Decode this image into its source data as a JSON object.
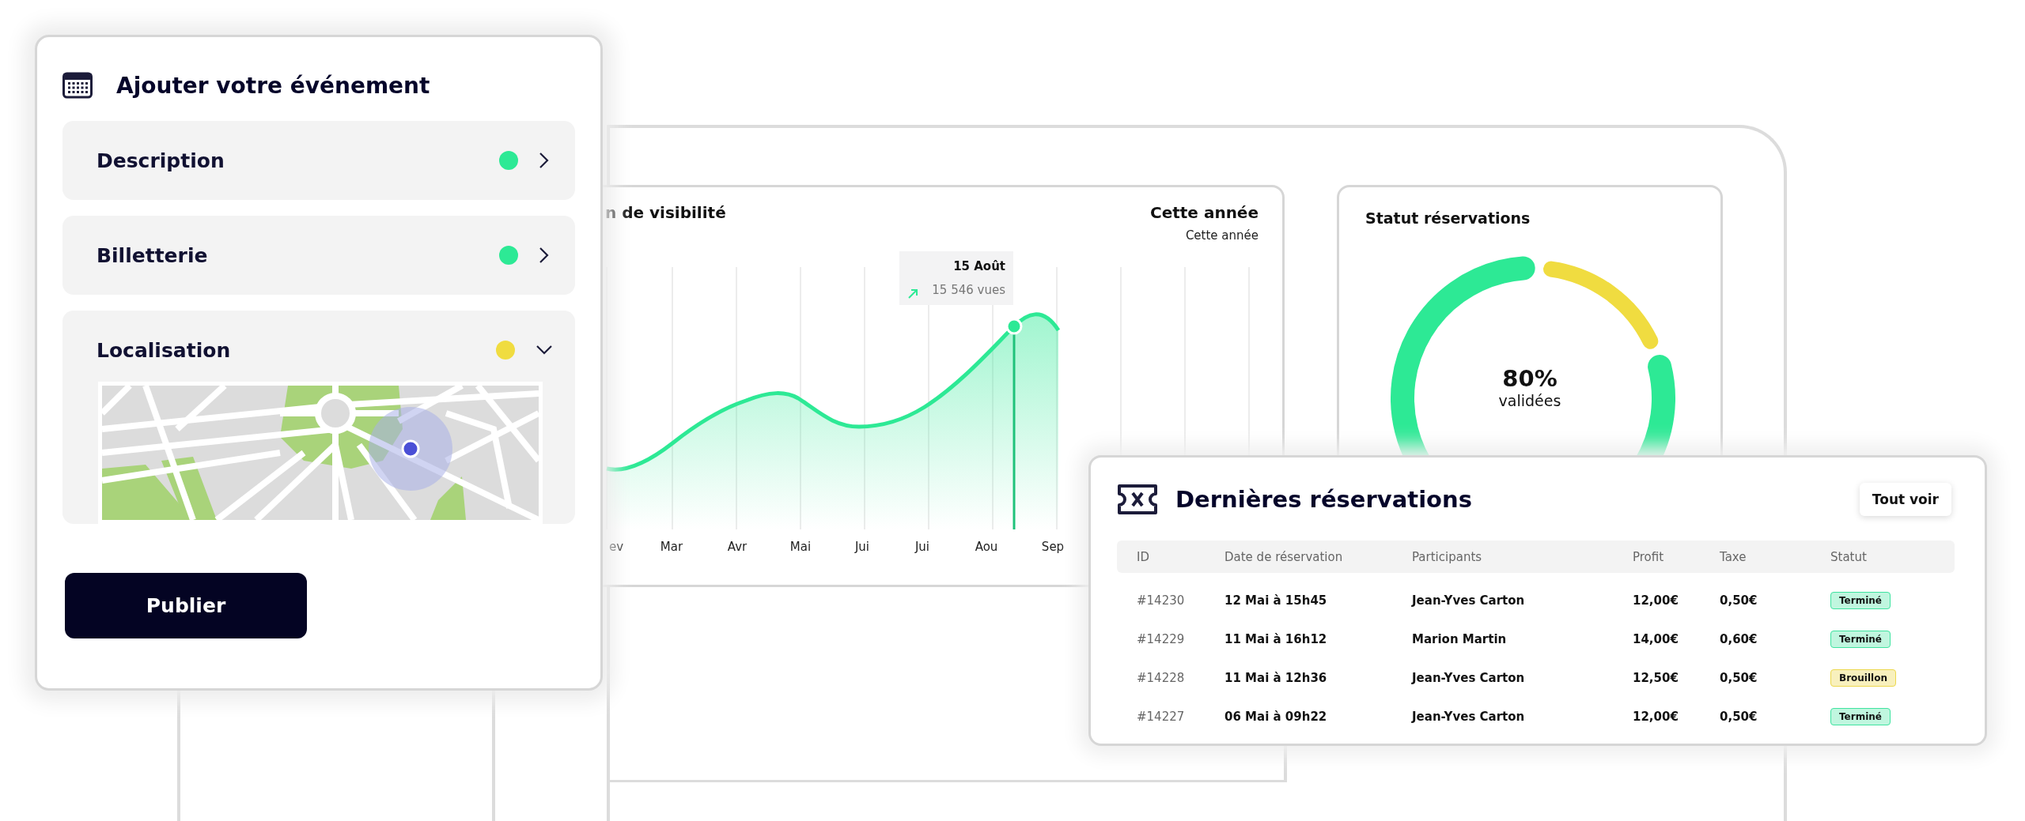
{
  "event_form": {
    "title": "Ajouter votre événement",
    "sections": [
      {
        "label": "Description",
        "color": "#2de995",
        "expanded": false
      },
      {
        "label": "Billetterie",
        "color": "#2de995",
        "expanded": false
      },
      {
        "label": "Localisation",
        "color": "#f0dc40",
        "expanded": true
      }
    ],
    "publish_button": "Publier"
  },
  "visibility_chart": {
    "title": "n de visibilité",
    "period_select": "Cette année",
    "period_label": "Cette année",
    "x_labels": [
      "ev",
      "Mar",
      "Avr",
      "Mai",
      "Jui",
      "Jui",
      "Aou",
      "Sep"
    ],
    "tooltip": {
      "date": "15 Août",
      "value": "15 546 vues"
    }
  },
  "booking_status": {
    "title": "Statut réservations",
    "percent": "80%",
    "caption": "validées"
  },
  "recent_bookings": {
    "title": "Dernières réservations",
    "view_all_button": "Tout voir",
    "columns": [
      "ID",
      "Date de réservation",
      "Participants",
      "Profit",
      "Taxe",
      "Statut"
    ],
    "rows": [
      {
        "id": "#14230",
        "date": "12 Mai à 15h45",
        "participant": "Jean-Yves Carton",
        "profit": "12,00€",
        "tax": "0,50€",
        "status": {
          "label": "Terminé",
          "kind": "done"
        }
      },
      {
        "id": "#14229",
        "date": "11 Mai à 16h12",
        "participant": "Marion Martin",
        "profit": "14,00€",
        "tax": "0,60€",
        "status": {
          "label": "Terminé",
          "kind": "done"
        }
      },
      {
        "id": "#14228",
        "date": "11 Mai à 12h36",
        "participant": "Jean-Yves Carton",
        "profit": "12,50€",
        "tax": "0,50€",
        "status": {
          "label": "Brouillon",
          "kind": "draft"
        }
      },
      {
        "id": "#14227",
        "date": "06 Mai à 09h22",
        "participant": "Jean-Yves Carton",
        "profit": "12,00€",
        "tax": "0,50€",
        "status": {
          "label": "Terminé",
          "kind": "done"
        }
      }
    ]
  }
}
